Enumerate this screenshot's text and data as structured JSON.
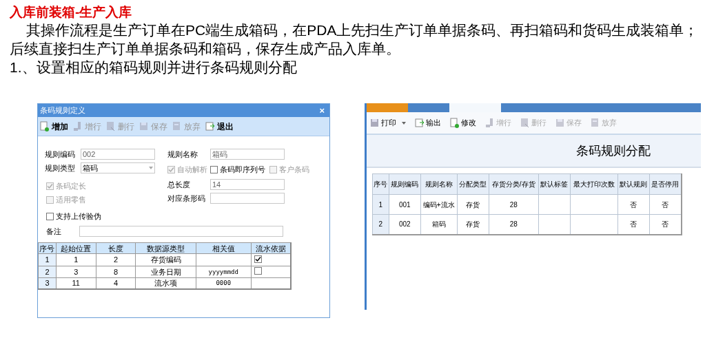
{
  "heading": "入库前装箱-生产入库",
  "intro_lines": [
    "其操作流程是生产订单在PC端生成箱码，在PDA上先扫生产订单单据条码、再扫箱码和货码生成装箱单；",
    "后续直接扫生产订单单据条码和箱码，保存生成产品入库单。"
  ],
  "step": "1.、设置相应的箱码规则并进行条码规则分配",
  "dialog": {
    "title": "条码规则定义",
    "close": "×",
    "toolbar": [
      {
        "label": "增加",
        "disabled": false
      },
      {
        "label": "增行",
        "disabled": true
      },
      {
        "label": "删行",
        "disabled": true
      },
      {
        "label": "保存",
        "disabled": true
      },
      {
        "label": "放弃",
        "disabled": true
      },
      {
        "label": "退出",
        "disabled": false
      }
    ],
    "fields": [
      {
        "label": "规则编码",
        "value": "002",
        "kind": "text"
      },
      {
        "label": "规则名称",
        "value": "箱码",
        "kind": "text"
      },
      {
        "label": "规则类型",
        "value": "箱码",
        "kind": "select"
      }
    ],
    "checkboxes_row": [
      {
        "label": "自动解析",
        "checked": true,
        "disabled": true
      },
      {
        "label": "条码即序列号",
        "checked": false,
        "disabled": false
      },
      {
        "label": "客户条码",
        "checked": false,
        "disabled": true
      }
    ],
    "checkboxes_left": [
      {
        "label": "条码定长",
        "checked": true,
        "disabled": true
      },
      {
        "label": "适用零售",
        "checked": false,
        "disabled": true
      },
      {
        "label": "支持上传验伪",
        "checked": false,
        "disabled": false
      }
    ],
    "fields_right": [
      {
        "label": "总长度",
        "value": "14"
      },
      {
        "label": "对应条形码"
      }
    ],
    "remark": {
      "label": "备注"
    },
    "table": {
      "columns": [
        "序号",
        "起始位置",
        "长度",
        "数据源类型",
        "相关值",
        "流水依据"
      ],
      "rows": [
        {
          "cells": [
            "1",
            "1",
            "2",
            "存货编码",
            ""
          ],
          "checked": true
        },
        {
          "cells": [
            "2",
            "3",
            "8",
            "业务日期",
            "yyyymmdd"
          ],
          "checked": false
        },
        {
          "cells": [
            "3",
            "11",
            "4",
            "流水项",
            "0000"
          ]
        }
      ]
    }
  },
  "app": {
    "toolbar": [
      {
        "label": "打印",
        "disabled": false,
        "dropdown": true
      },
      {
        "label": "输出",
        "disabled": false,
        "dropdown": false
      },
      {
        "label": "修改",
        "disabled": false,
        "dropdown": false
      },
      {
        "label": "增行",
        "disabled": true,
        "dropdown": false
      },
      {
        "label": "删行",
        "disabled": true,
        "dropdown": false
      },
      {
        "label": "保存",
        "disabled": true,
        "dropdown": false
      },
      {
        "label": "放弃",
        "disabled": true,
        "dropdown": false
      }
    ],
    "title": "条码规则分配",
    "table": {
      "columns": [
        "序号",
        "规则编码",
        "规则名称",
        "分配类型",
        "存货分类/存货",
        "默认标签",
        "最大打印次数",
        "默认规则",
        "是否停用"
      ],
      "rows": [
        [
          "1",
          "001",
          "编码+流水",
          "存货",
          "28",
          "",
          "",
          "否",
          "否"
        ],
        [
          "2",
          "002",
          "箱码",
          "存货",
          "28",
          "",
          "",
          "否",
          "否"
        ]
      ]
    }
  }
}
